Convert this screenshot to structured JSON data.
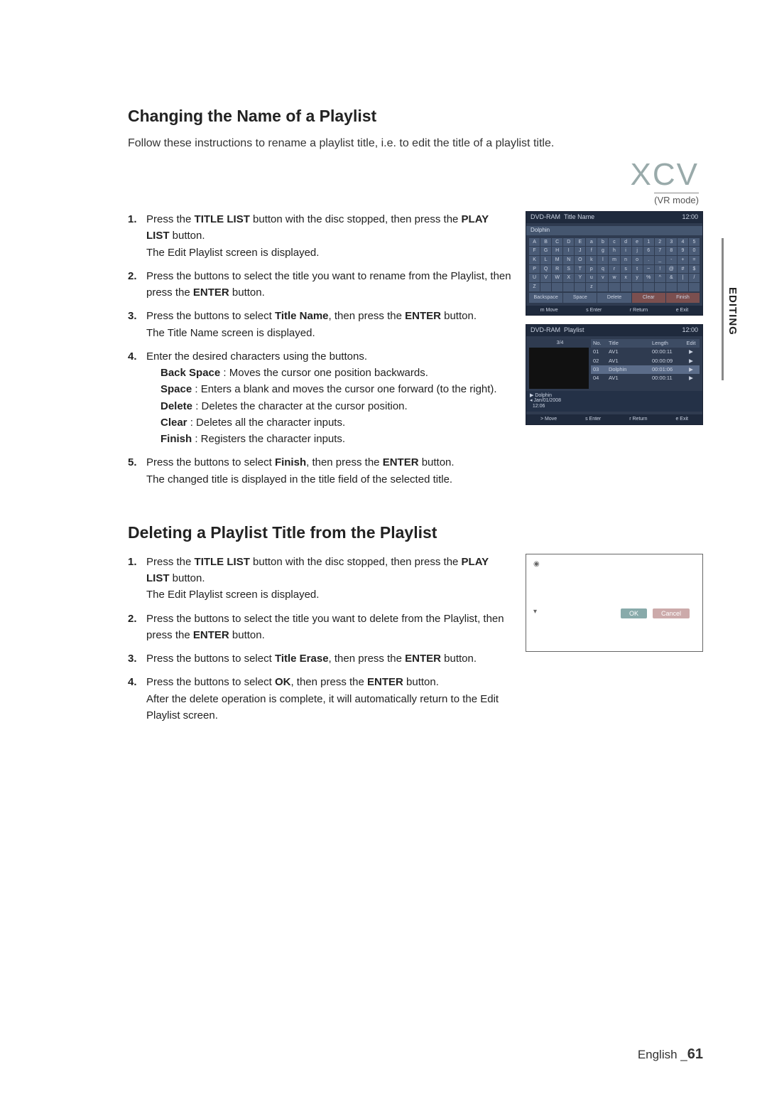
{
  "sideTab": "EDITING",
  "sectionA": {
    "title": "Changing the Name of a Playlist",
    "lead": "Follow these instructions to rename a playlist title, i.e. to edit the title of a playlist title.",
    "stampMain": "XCV",
    "stampSub": "(VR mode)",
    "steps": {
      "s1a": "Press the ",
      "s1b": "TITLE LIST",
      "s1c": " button with the disc stopped, then press the ",
      "s1d": "PLAY LIST",
      "s1e": " button.",
      "s1f": "The Edit Playlist screen is displayed.",
      "s2a": "Press the             buttons to select the title you want to rename from the Playlist, then press the ",
      "s2b": "ENTER",
      "s2c": " button.",
      "s3a": "Press the             buttons to select ",
      "s3b": "Title Name",
      "s3c": ", then press the ",
      "s3d": "ENTER",
      "s3e": " button.",
      "s3f": "The Title Name screen is displayed.",
      "s4a": "Enter the desired characters using the                     buttons.",
      "s4b1": "Back Space",
      "s4b2": " : Moves the cursor one position backwards.",
      "s4c1": "Space",
      "s4c2": " : Enters a blank and moves the cursor one forward (to the right).",
      "s4d1": "Delete",
      "s4d2": " : Deletes the character at the cursor position.",
      "s4e1": "Clear",
      "s4e2": " : Deletes all the character inputs.",
      "s4f1": "Finish",
      "s4f2": " : Registers the character inputs.",
      "s5a": "Press the                     buttons to select ",
      "s5b": "Finish",
      "s5c": ", then press the ",
      "s5d": "ENTER",
      "s5e": " button.",
      "s5f": "The changed title is displayed in the title field of the selected title."
    }
  },
  "titleNameScreen": {
    "brand": "DVD-RAM",
    "title": "Title Name",
    "clock": "12:00",
    "current": "Dolphin",
    "keysR1": [
      "A",
      "B",
      "C",
      "D",
      "E",
      "a",
      "b",
      "c",
      "d",
      "e",
      "1",
      "2",
      "3",
      "4",
      "5"
    ],
    "keysR2": [
      "F",
      "G",
      "H",
      "I",
      "J",
      "f",
      "g",
      "h",
      "i",
      "j",
      "6",
      "7",
      "8",
      "9",
      "0"
    ],
    "keysR3": [
      "K",
      "L",
      "M",
      "N",
      "O",
      "k",
      "l",
      "m",
      "n",
      "o",
      ".",
      "_",
      "-",
      "+",
      "="
    ],
    "keysR4": [
      "P",
      "Q",
      "R",
      "S",
      "T",
      "p",
      "q",
      "r",
      "s",
      "t",
      "~",
      "!",
      "@",
      "#",
      "$"
    ],
    "keysR5": [
      "U",
      "V",
      "W",
      "X",
      "Y",
      "u",
      "v",
      "w",
      "x",
      "y",
      "%",
      "^",
      "&",
      "|",
      "/"
    ],
    "keysR6": [
      "Z",
      "",
      "",
      "",
      "",
      "z",
      "",
      "",
      "",
      "",
      "",
      "",
      "",
      "",
      ""
    ],
    "wide": [
      "Backspace",
      "Space",
      "Delete",
      "Clear",
      "Finish"
    ],
    "ftr": [
      "m  Move",
      "s  Enter",
      "r  Return",
      "e  Exit"
    ]
  },
  "playlistScreen": {
    "brand": "DVD-RAM",
    "title": "Playlist",
    "clock": "12:00",
    "counter": "3/4",
    "cols": [
      "No.",
      "Title",
      "Length",
      "Edit"
    ],
    "rows": [
      {
        "no": "01",
        "title": "AV1",
        "len": "00:00:11",
        "edit": "▶"
      },
      {
        "no": "02",
        "title": "AV1",
        "len": "00:00:09",
        "edit": "▶"
      },
      {
        "no": "03",
        "title": "Dolphin",
        "len": "00:01:06",
        "edit": "▶",
        "sel": true
      },
      {
        "no": "04",
        "title": "AV1",
        "len": "00:00:11",
        "edit": "▶"
      }
    ],
    "metaName": "Dolphin",
    "metaDate": "Jan/01/2008",
    "metaTime": "12:06",
    "ftr": [
      ">  Move",
      "s  Enter",
      "r  Return",
      "e  Exit"
    ]
  },
  "sectionB": {
    "title": "Deleting a Playlist Title from the Playlist",
    "steps": {
      "s1a": "Press the ",
      "s1b": "TITLE LIST",
      "s1c": " button with the disc stopped, then press the ",
      "s1d": "PLAY LIST",
      "s1e": " button.",
      "s1f": "The Edit Playlist screen is displayed.",
      "s2a": "Press the             buttons to select the title you want to delete from the Playlist, then press the ",
      "s2b": "ENTER",
      "s2c": " button.",
      "s3a": "Press the             buttons to select ",
      "s3b": "Title Erase",
      "s3c": ", then press the ",
      "s3d": "ENTER",
      "s3e": " button.",
      "s4a": "Press the             buttons to select ",
      "s4b": "OK",
      "s4c": ", then press the ",
      "s4d": "ENTER",
      "s4e": " button.",
      "s4f": "After the delete operation is complete, it will automatically return to the Edit Playlist screen."
    }
  },
  "dialog": {
    "ok": "OK",
    "cancel": "Cancel"
  },
  "footer": {
    "lang": "English _",
    "page": "61"
  }
}
